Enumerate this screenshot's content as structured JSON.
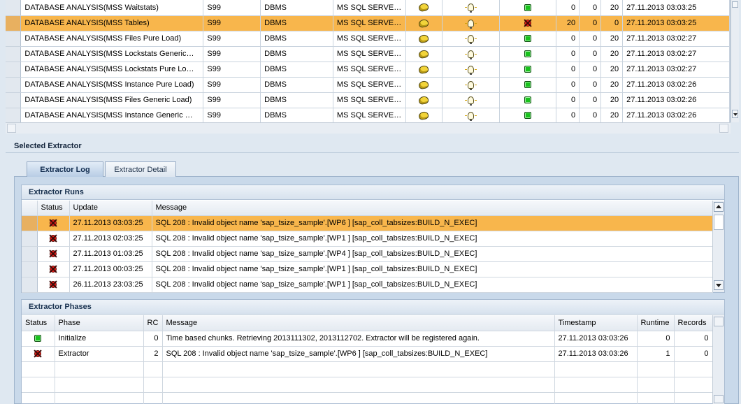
{
  "top_grid": {
    "rows": [
      {
        "name": "DATABASE ANALYSIS(MSS Waitstats)",
        "sid": "S99",
        "category": "DBMS",
        "db": "MS SQL SERVE…",
        "status": "green",
        "v1": "0",
        "v2": "0",
        "v3": "20",
        "ts": "27.11.2013 03:03:25",
        "highlight": false
      },
      {
        "name": "DATABASE ANALYSIS(MSS Tables)",
        "sid": "S99",
        "category": "DBMS",
        "db": "MS SQL SERVE…",
        "status": "red",
        "v1": "20",
        "v2": "0",
        "v3": "0",
        "ts": "27.11.2013 03:03:25",
        "highlight": true
      },
      {
        "name": "DATABASE ANALYSIS(MSS Files Pure Load)",
        "sid": "S99",
        "category": "DBMS",
        "db": "MS SQL SERVE…",
        "status": "green",
        "v1": "0",
        "v2": "0",
        "v3": "20",
        "ts": "27.11.2013 03:02:27",
        "highlight": false
      },
      {
        "name": "DATABASE ANALYSIS(MSS Lockstats Generic…",
        "sid": "S99",
        "category": "DBMS",
        "db": "MS SQL SERVE…",
        "status": "green",
        "v1": "0",
        "v2": "0",
        "v3": "20",
        "ts": "27.11.2013 03:02:27",
        "highlight": false
      },
      {
        "name": "DATABASE ANALYSIS(MSS Lockstats Pure Lo…",
        "sid": "S99",
        "category": "DBMS",
        "db": "MS SQL SERVE…",
        "status": "green",
        "v1": "0",
        "v2": "0",
        "v3": "20",
        "ts": "27.11.2013 03:02:27",
        "highlight": false
      },
      {
        "name": "DATABASE ANALYSIS(MSS Instance Pure Load)",
        "sid": "S99",
        "category": "DBMS",
        "db": "MS SQL SERVE…",
        "status": "green",
        "v1": "0",
        "v2": "0",
        "v3": "20",
        "ts": "27.11.2013 03:02:26",
        "highlight": false
      },
      {
        "name": "DATABASE ANALYSIS(MSS Files Generic Load)",
        "sid": "S99",
        "category": "DBMS",
        "db": "MS SQL SERVE…",
        "status": "green",
        "v1": "0",
        "v2": "0",
        "v3": "20",
        "ts": "27.11.2013 03:02:26",
        "highlight": false
      },
      {
        "name": "DATABASE ANALYSIS(MSS Instance Generic …",
        "sid": "S99",
        "category": "DBMS",
        "db": "MS SQL SERVE…",
        "status": "green",
        "v1": "0",
        "v2": "0",
        "v3": "20",
        "ts": "27.11.2013 03:02:26",
        "highlight": false
      }
    ]
  },
  "selected_extractor": {
    "title": "Selected Extractor",
    "tabs": [
      {
        "label": "Extractor Log",
        "active": true
      },
      {
        "label": "Extractor Detail",
        "active": false
      }
    ]
  },
  "runs": {
    "title": "Extractor Runs",
    "columns": [
      "Status",
      "Update",
      "Message"
    ],
    "rows": [
      {
        "status": "red",
        "update": "27.11.2013 03:03:25",
        "message": "SQL 208 : Invalid object name 'sap_tsize_sample'.[WP6 ] [sap_coll_tabsizes:BUILD_N_EXEC]",
        "highlight": true
      },
      {
        "status": "red",
        "update": "27.11.2013 02:03:25",
        "message": "SQL 208 : Invalid object name 'sap_tsize_sample'.[WP1 ] [sap_coll_tabsizes:BUILD_N_EXEC]",
        "highlight": false
      },
      {
        "status": "red",
        "update": "27.11.2013 01:03:25",
        "message": "SQL 208 : Invalid object name 'sap_tsize_sample'.[WP4 ] [sap_coll_tabsizes:BUILD_N_EXEC]",
        "highlight": false
      },
      {
        "status": "red",
        "update": "27.11.2013 00:03:25",
        "message": "SQL 208 : Invalid object name 'sap_tsize_sample'.[WP1 ] [sap_coll_tabsizes:BUILD_N_EXEC]",
        "highlight": false
      },
      {
        "status": "red",
        "update": "26.11.2013 23:03:25",
        "message": "SQL 208 : Invalid object name 'sap_tsize_sample'.[WP1 ] [sap_coll_tabsizes:BUILD_N_EXEC]",
        "highlight": false
      }
    ]
  },
  "phases": {
    "title": "Extractor Phases",
    "columns": [
      "Status",
      "Phase",
      "RC",
      "Message",
      "Timestamp",
      "Runtime",
      "Records"
    ],
    "rows": [
      {
        "status": "green",
        "phase": "Initialize",
        "rc": "0",
        "message": "Time based chunks. Retrieving 2013111302, 2013112702. Extractor will be registered again.",
        "timestamp": "27.11.2013 03:03:26",
        "runtime": "0",
        "records": "0"
      },
      {
        "status": "red",
        "phase": "Extractor",
        "rc": "2",
        "message": "SQL 208 : Invalid object name 'sap_tsize_sample'.[WP6 ] [sap_coll_tabsizes:BUILD_N_EXEC]",
        "timestamp": "27.11.2013 03:03:26",
        "runtime": "1",
        "records": "0"
      }
    ]
  },
  "colors": {
    "highlight": "#f8b64c",
    "ok": "#18c21c",
    "error": "#e8201a"
  }
}
